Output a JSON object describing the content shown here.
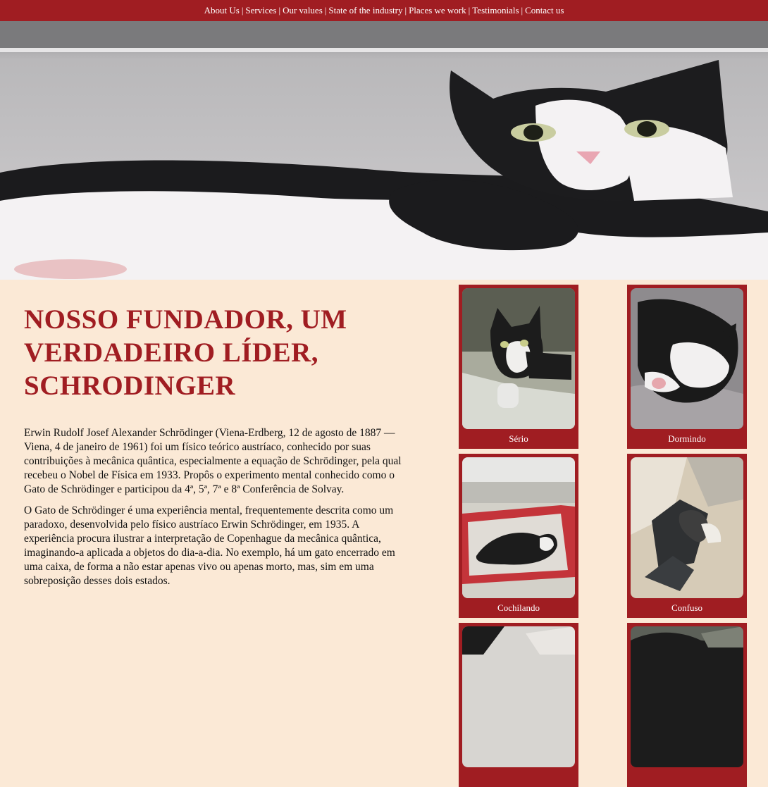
{
  "nav": {
    "items": [
      "About Us",
      "Services",
      "Our values",
      "State of the industry",
      "Places we work",
      "Testimonials",
      "Contact us"
    ],
    "separator": "|"
  },
  "hero": {
    "icon": "cat-photo"
  },
  "main": {
    "title": "NOSSO FUNDADOR, UM VERDADEIRO LÍDER, SCHRODINGER",
    "paragraphs": [
      "Erwin Rudolf Josef Alexander Schrödinger (Viena-Erdberg, 12 de agosto de 1887 — Viena, 4 de janeiro de 1961) foi um físico teórico austríaco, conhecido por suas contribuições à mecânica quântica, especialmente a equação de Schrödinger, pela qual recebeu o Nobel de Física em 1933. Propôs o experimento mental conhecido como o Gato de Schrödinger e participou da 4ª, 5ª, 7ª e 8ª Conferência de Solvay.",
      "O Gato de Schrödinger é uma experiência mental, frequentemente descrita como um paradoxo, desenvolvida pelo físico austríaco Erwin Schrödinger, em 1935. A experiência procura ilustrar a interpretação de Copenhague da mecânica quântica, imaginando-a aplicada a objetos do dia-a-dia. No exemplo, há um gato encerrado em uma caixa, de forma a não estar apenas vivo ou apenas morto, mas, sim em uma sobreposição desses dois estados."
    ]
  },
  "gallery": [
    {
      "caption": "Sério"
    },
    {
      "caption": "Dormindo"
    },
    {
      "caption": "Cochilando"
    },
    {
      "caption": "Confuso"
    },
    {
      "caption": ""
    },
    {
      "caption": ""
    }
  ],
  "colors": {
    "accent": "#a01d22",
    "background": "#fbe9d6"
  }
}
